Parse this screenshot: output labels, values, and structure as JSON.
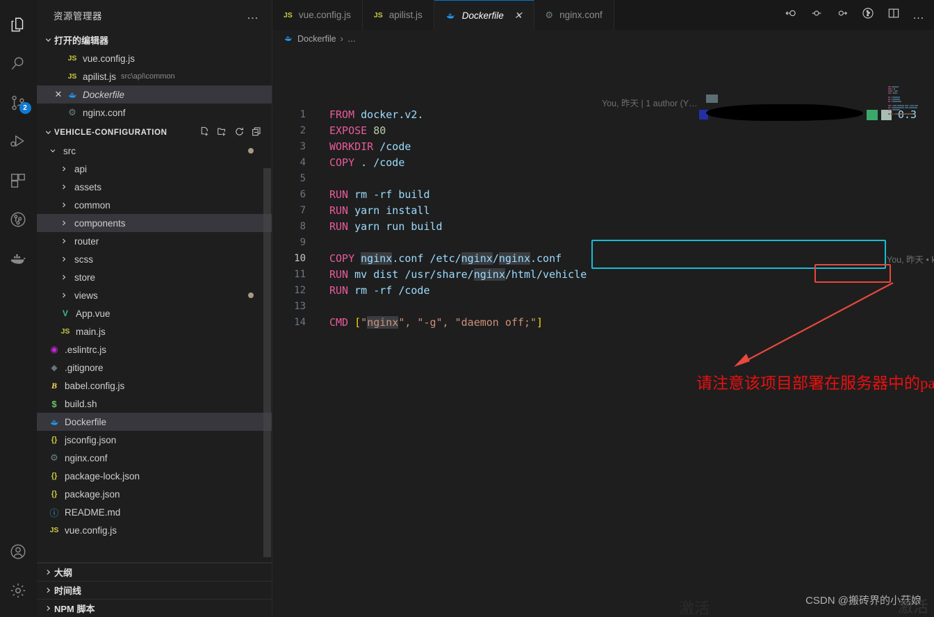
{
  "activity_bar": {
    "items": [
      {
        "name": "explorer",
        "icon": "files-icon",
        "active": true,
        "badge": ""
      },
      {
        "name": "search",
        "icon": "search-icon",
        "active": false,
        "badge": ""
      },
      {
        "name": "source-control",
        "icon": "source-control-icon",
        "active": false,
        "badge": "2"
      },
      {
        "name": "run-and-debug",
        "icon": "run-debug-icon",
        "active": false,
        "badge": ""
      },
      {
        "name": "extensions",
        "icon": "extensions-icon",
        "active": false,
        "badge": ""
      },
      {
        "name": "gitlens",
        "icon": "gitlens-icon",
        "active": false,
        "badge": ""
      },
      {
        "name": "docker",
        "icon": "docker-whale-icon",
        "active": false,
        "badge": ""
      }
    ],
    "bottom_items": [
      {
        "name": "accounts",
        "icon": "account-icon"
      },
      {
        "name": "manage",
        "icon": "gear-icon"
      }
    ]
  },
  "sidebar": {
    "title": "资源管理器",
    "more_actions": "…",
    "open_editors": {
      "label": "打开的编辑器",
      "expanded": true,
      "items": [
        {
          "name": "vue.config.js",
          "icon": "js-icon",
          "sub": "",
          "selected": false,
          "italic": false,
          "close": false
        },
        {
          "name": "apilist.js",
          "icon": "js-icon",
          "sub": "src\\api\\common",
          "selected": false,
          "italic": false,
          "close": false
        },
        {
          "name": "Dockerfile",
          "icon": "docker-icon",
          "sub": "",
          "selected": true,
          "italic": true,
          "close": true
        },
        {
          "name": "nginx.conf",
          "icon": "gear-icon",
          "sub": "",
          "selected": false,
          "italic": false,
          "close": false
        }
      ]
    },
    "project": {
      "label": "VEHICLE-CONFIGURATION",
      "expanded": true,
      "actions": [
        "new-file-icon",
        "new-folder-icon",
        "refresh-icon",
        "collapse-all-icon"
      ],
      "tree": [
        {
          "name": "src",
          "type": "folder",
          "depth": 1,
          "expanded": true,
          "dirty": true,
          "icon": "",
          "selected": false
        },
        {
          "name": "api",
          "type": "folder",
          "depth": 2,
          "expanded": false,
          "dirty": false,
          "icon": "",
          "selected": false
        },
        {
          "name": "assets",
          "type": "folder",
          "depth": 2,
          "expanded": false,
          "dirty": false,
          "icon": "",
          "selected": false
        },
        {
          "name": "common",
          "type": "folder",
          "depth": 2,
          "expanded": false,
          "dirty": false,
          "icon": "",
          "selected": false
        },
        {
          "name": "components",
          "type": "folder",
          "depth": 2,
          "expanded": false,
          "dirty": false,
          "icon": "",
          "selected": true
        },
        {
          "name": "router",
          "type": "folder",
          "depth": 2,
          "expanded": false,
          "dirty": false,
          "icon": "",
          "selected": false
        },
        {
          "name": "scss",
          "type": "folder",
          "depth": 2,
          "expanded": false,
          "dirty": false,
          "icon": "",
          "selected": false
        },
        {
          "name": "store",
          "type": "folder",
          "depth": 2,
          "expanded": false,
          "dirty": false,
          "icon": "",
          "selected": false
        },
        {
          "name": "views",
          "type": "folder",
          "depth": 2,
          "expanded": false,
          "dirty": true,
          "icon": "",
          "selected": false
        },
        {
          "name": "App.vue",
          "type": "file",
          "depth": 2,
          "expanded": false,
          "dirty": false,
          "icon": "vue-icon",
          "selected": false
        },
        {
          "name": "main.js",
          "type": "file",
          "depth": 2,
          "expanded": false,
          "dirty": false,
          "icon": "js-icon",
          "selected": false
        },
        {
          "name": ".eslintrc.js",
          "type": "file",
          "depth": 1,
          "expanded": false,
          "dirty": false,
          "icon": "eslint-icon",
          "selected": false
        },
        {
          "name": ".gitignore",
          "type": "file",
          "depth": 1,
          "expanded": false,
          "dirty": false,
          "icon": "git-icon",
          "selected": false
        },
        {
          "name": "babel.config.js",
          "type": "file",
          "depth": 1,
          "expanded": false,
          "dirty": false,
          "icon": "babel-icon",
          "selected": false
        },
        {
          "name": "build.sh",
          "type": "file",
          "depth": 1,
          "expanded": false,
          "dirty": false,
          "icon": "shell-icon",
          "selected": false
        },
        {
          "name": "Dockerfile",
          "type": "file",
          "depth": 1,
          "expanded": false,
          "dirty": false,
          "icon": "docker-icon",
          "selected": true
        },
        {
          "name": "jsconfig.json",
          "type": "file",
          "depth": 1,
          "expanded": false,
          "dirty": false,
          "icon": "json-icon",
          "selected": false
        },
        {
          "name": "nginx.conf",
          "type": "file",
          "depth": 1,
          "expanded": false,
          "dirty": false,
          "icon": "gear-icon",
          "selected": false
        },
        {
          "name": "package-lock.json",
          "type": "file",
          "depth": 1,
          "expanded": false,
          "dirty": false,
          "icon": "json-icon",
          "selected": false
        },
        {
          "name": "package.json",
          "type": "file",
          "depth": 1,
          "expanded": false,
          "dirty": false,
          "icon": "json-icon",
          "selected": false
        },
        {
          "name": "README.md",
          "type": "file",
          "depth": 1,
          "expanded": false,
          "dirty": false,
          "icon": "markdown-icon",
          "selected": false
        },
        {
          "name": "vue.config.js",
          "type": "file",
          "depth": 1,
          "expanded": false,
          "dirty": false,
          "icon": "js-icon",
          "selected": false
        }
      ]
    },
    "bottom_sections": [
      {
        "label": "大纲",
        "expanded": false
      },
      {
        "label": "时间线",
        "expanded": false
      },
      {
        "label": "NPM 脚本",
        "expanded": false
      }
    ]
  },
  "editor": {
    "tabs": [
      {
        "label": "vue.config.js",
        "icon": "js-icon",
        "active": false,
        "dirty": false,
        "closable": false
      },
      {
        "label": "apilist.js",
        "icon": "js-icon",
        "active": false,
        "dirty": false,
        "closable": false
      },
      {
        "label": "Dockerfile",
        "icon": "docker-icon",
        "active": true,
        "dirty": false,
        "closable": true
      },
      {
        "label": "nginx.conf",
        "icon": "gear-icon",
        "active": false,
        "dirty": false,
        "closable": false
      }
    ],
    "tab_actions": [
      "gitlens-open-changes-icon",
      "gitlens-previous-change-icon",
      "gitlens-next-change-icon",
      "gitlens-toggle-blame-icon",
      "split-editor-icon",
      "more-actions-icon"
    ],
    "breadcrumb": {
      "icon": "docker-icon",
      "file": "Dockerfile",
      "separator": "›",
      "rest": "…"
    },
    "blame_header": "You, 昨天 | 1 author (Y…",
    "blame_version": "0.3",
    "inline_blame": "You, 昨天 • kuayu",
    "lines": [
      {
        "no": "1",
        "tokens": [
          {
            "t": "FROM",
            "c": "kw"
          },
          {
            "t": " docker.v2.",
            "c": "path"
          }
        ]
      },
      {
        "no": "2",
        "tokens": [
          {
            "t": "EXPOSE",
            "c": "kw"
          },
          {
            "t": " ",
            "c": "plain"
          },
          {
            "t": "80",
            "c": "num"
          }
        ]
      },
      {
        "no": "3",
        "tokens": [
          {
            "t": "WORKDIR",
            "c": "kw"
          },
          {
            "t": " ",
            "c": "plain"
          },
          {
            "t": "/code",
            "c": "path"
          }
        ]
      },
      {
        "no": "4",
        "tokens": [
          {
            "t": "COPY",
            "c": "kw"
          },
          {
            "t": " ",
            "c": "plain"
          },
          {
            "t": ". /code",
            "c": "path"
          }
        ]
      },
      {
        "no": "5",
        "tokens": []
      },
      {
        "no": "6",
        "tokens": [
          {
            "t": "RUN",
            "c": "kw"
          },
          {
            "t": " ",
            "c": "plain"
          },
          {
            "t": "rm -rf build",
            "c": "path"
          }
        ]
      },
      {
        "no": "7",
        "tokens": [
          {
            "t": "RUN",
            "c": "kw"
          },
          {
            "t": " ",
            "c": "plain"
          },
          {
            "t": "yarn install",
            "c": "path"
          }
        ]
      },
      {
        "no": "8",
        "tokens": [
          {
            "t": "RUN",
            "c": "kw"
          },
          {
            "t": " ",
            "c": "plain"
          },
          {
            "t": "yarn run build",
            "c": "path"
          }
        ]
      },
      {
        "no": "9",
        "tokens": []
      },
      {
        "no": "10",
        "tokens": [
          {
            "t": "COPY",
            "c": "kw"
          },
          {
            "t": " ",
            "c": "plain"
          },
          {
            "t": "nginx",
            "c": "path occ"
          },
          {
            "t": ".conf /etc/",
            "c": "path"
          },
          {
            "t": "nginx",
            "c": "path occ"
          },
          {
            "t": "/",
            "c": "path"
          },
          {
            "t": "nginx",
            "c": "path occ"
          },
          {
            "t": ".conf",
            "c": "path"
          }
        ]
      },
      {
        "no": "11",
        "tokens": [
          {
            "t": "RUN",
            "c": "kw"
          },
          {
            "t": " ",
            "c": "plain"
          },
          {
            "t": "mv dist /usr/share/",
            "c": "path"
          },
          {
            "t": "nginx",
            "c": "path occ"
          },
          {
            "t": "/html/vehicle",
            "c": "path"
          }
        ]
      },
      {
        "no": "12",
        "tokens": [
          {
            "t": "RUN",
            "c": "kw"
          },
          {
            "t": " ",
            "c": "plain"
          },
          {
            "t": "rm -rf /code",
            "c": "path"
          }
        ]
      },
      {
        "no": "13",
        "tokens": []
      },
      {
        "no": "14",
        "tokens": [
          {
            "t": "CMD",
            "c": "kw"
          },
          {
            "t": " ",
            "c": "plain"
          },
          {
            "t": "[",
            "c": "brk"
          },
          {
            "t": "\"",
            "c": "str"
          },
          {
            "t": "nginx",
            "c": "str occ"
          },
          {
            "t": "\", \"-g\", \"daemon off;\"",
            "c": "str"
          },
          {
            "t": "]",
            "c": "brk"
          }
        ]
      }
    ],
    "annotation": {
      "note": "请注意该项目部署在服务器中的path为/vehicle",
      "note_color": "#e8100f",
      "cyan_box_color": "#19bcd4",
      "red_box_color": "#e8483e",
      "arrow_color": "#e8483e"
    }
  },
  "watermark": {
    "text": "CSDN @搬砖界的小菇娘",
    "ghost": "激活",
    "ghost2": "激活"
  }
}
